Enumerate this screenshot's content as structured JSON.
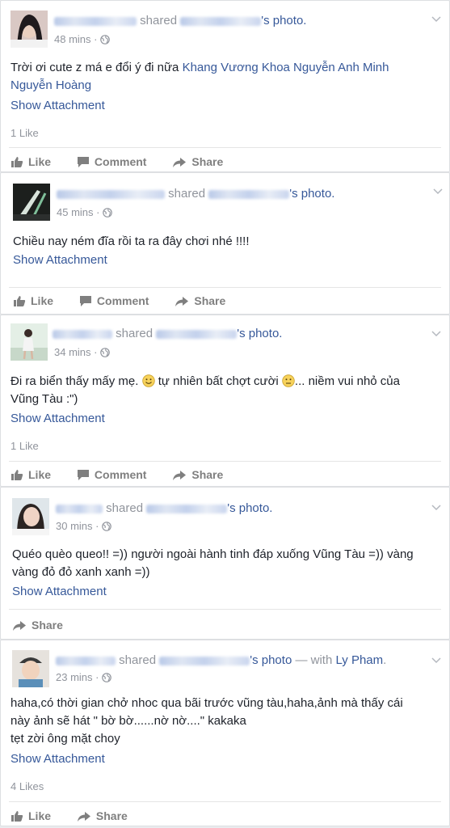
{
  "labels": {
    "shared": "shared",
    "photo_suffix": "'s photo.",
    "photo_suffix_no_dot": "'s photo",
    "with_prefix": " — with ",
    "show_attachment": "Show Attachment",
    "like": "Like",
    "comment": "Comment",
    "share": "Share"
  },
  "posts": [
    {
      "time": "48 mins",
      "text": "Trời ơi cute z má e đổi ý đi nữa",
      "tags": "Khang Vương Khoa Nguyễn Anh Minh Nguyễn Hoàng",
      "likes": "1 Like"
    },
    {
      "time": "45 mins",
      "text": "Chiều nay ném đĩa rồi ta ra đây chơi nhé !!!!"
    },
    {
      "time": "34 mins",
      "text_a": "Đi ra biển thấy mấy mẹ.",
      "text_b": "tự nhiên bất chợt cười",
      "text_c": "... niềm vui nhỏ của",
      "text_d": "Vũng Tàu :\")",
      "likes": "1 Like"
    },
    {
      "time": "30 mins",
      "text_1": "Quéo quèo queo!! =)) người ngoài hành tinh đáp xuống Vũng Tàu =)) vàng",
      "text_2": "vàng đỏ đỏ xanh xanh =))"
    },
    {
      "time": "23 mins",
      "with_name": "Ly Pham",
      "text_1": "haha,có thời gian chở nhoc qua bãi trước vũng tàu,haha,ảnh mà thấy cái",
      "text_2": "này ảnh sẽ hát \" bờ bờ......nờ nờ....\" kakaka",
      "text_3": "tẹt zời ông mặt choy",
      "likes": "4 Likes"
    }
  ]
}
